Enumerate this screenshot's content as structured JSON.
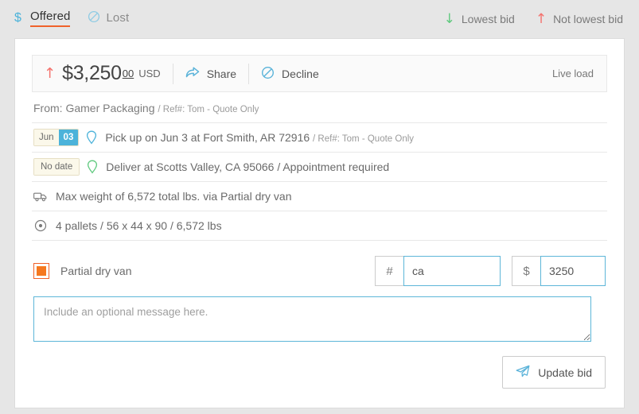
{
  "topbar": {
    "tabs": [
      {
        "label": "Offered",
        "icon": "dollar-icon",
        "active": true
      },
      {
        "label": "Lost",
        "icon": "ban-icon",
        "active": false
      }
    ],
    "legend": [
      {
        "label": "Lowest bid",
        "icon": "arrow-down-icon",
        "glyph": "↓",
        "color": "#5fc97e"
      },
      {
        "label": "Not lowest bid",
        "icon": "arrow-up-icon",
        "glyph": "↑",
        "color": "#f4736e"
      }
    ]
  },
  "card": {
    "price": {
      "trend_glyph": "↑",
      "trend_color": "#f4736e",
      "amount": "$3,250",
      "cents": "00",
      "currency": "USD",
      "share_label": "Share",
      "decline_label": "Decline",
      "load_type": "Live load"
    },
    "from": {
      "prefix": "From: Gamer Packaging",
      "ref": "/ Ref#: Tom - Quote Only"
    },
    "pickup": {
      "badge_month": "Jun",
      "badge_day": "03",
      "text": "Pick up on Jun 3 at Fort Smith, AR 72916",
      "ref": "/ Ref#: Tom - Quote Only",
      "pin_color": "#4cb3da"
    },
    "delivery": {
      "badge_text": "No date",
      "text": "Deliver at Scotts Valley, CA 95066 / Appointment required",
      "pin_color": "#5fc97e"
    },
    "weight": {
      "text": "Max weight of 6,572 total lbs. via Partial dry van"
    },
    "pallets": {
      "text": "4 pallets / 56 x 44 x 90 / 6,572 lbs"
    },
    "bid": {
      "equipment_label": "Partial dry van",
      "count_addon": "#",
      "count_value": "ca",
      "price_addon": "$",
      "price_value": "3250",
      "message_placeholder": "Include an optional message here.",
      "message_value": "",
      "submit_label": "Update bid"
    }
  }
}
